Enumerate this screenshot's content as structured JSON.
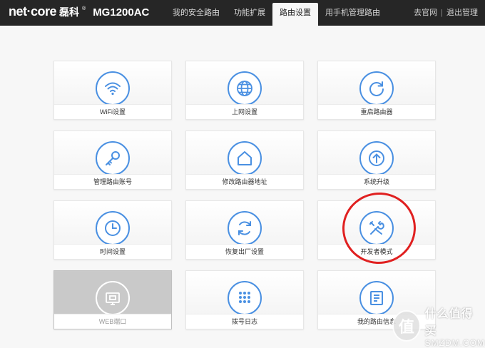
{
  "header": {
    "logo": "net·core",
    "logo_cn": "磊科",
    "reg_mark": "®",
    "model": "MG1200AC",
    "tabs": [
      {
        "label": "我的安全路由",
        "active": false
      },
      {
        "label": "功能扩展",
        "active": false
      },
      {
        "label": "路由设置",
        "active": true
      },
      {
        "label": "用手机管理路由",
        "active": false
      }
    ],
    "links": {
      "official": "去官网",
      "separator": "|",
      "logout": "退出管理"
    }
  },
  "cards": [
    {
      "label": "WiFi设置",
      "icon": "wifi-icon"
    },
    {
      "label": "上网设置",
      "icon": "globe-icon"
    },
    {
      "label": "重启路由器",
      "icon": "restart-icon"
    },
    {
      "label": "管理路由账号",
      "icon": "key-icon"
    },
    {
      "label": "修改路由器地址",
      "icon": "home-icon"
    },
    {
      "label": "系统升级",
      "icon": "upgrade-icon"
    },
    {
      "label": "时间设置",
      "icon": "clock-icon"
    },
    {
      "label": "恢复出厂设置",
      "icon": "factory-reset-icon"
    },
    {
      "label": "开发者模式",
      "icon": "tools-icon"
    },
    {
      "label": "WEB端口",
      "icon": "web-port-icon",
      "disabled": true
    },
    {
      "label": "拨号日志",
      "icon": "dial-log-icon"
    },
    {
      "label": "我的路由信息",
      "icon": "router-info-icon"
    }
  ],
  "watermark": {
    "title": "什么值得买",
    "site": "SMZDM.COM",
    "badge": "值"
  },
  "colors": {
    "accent": "#4a90e2",
    "header_bg": "#262626",
    "annotation": "#e02020"
  }
}
